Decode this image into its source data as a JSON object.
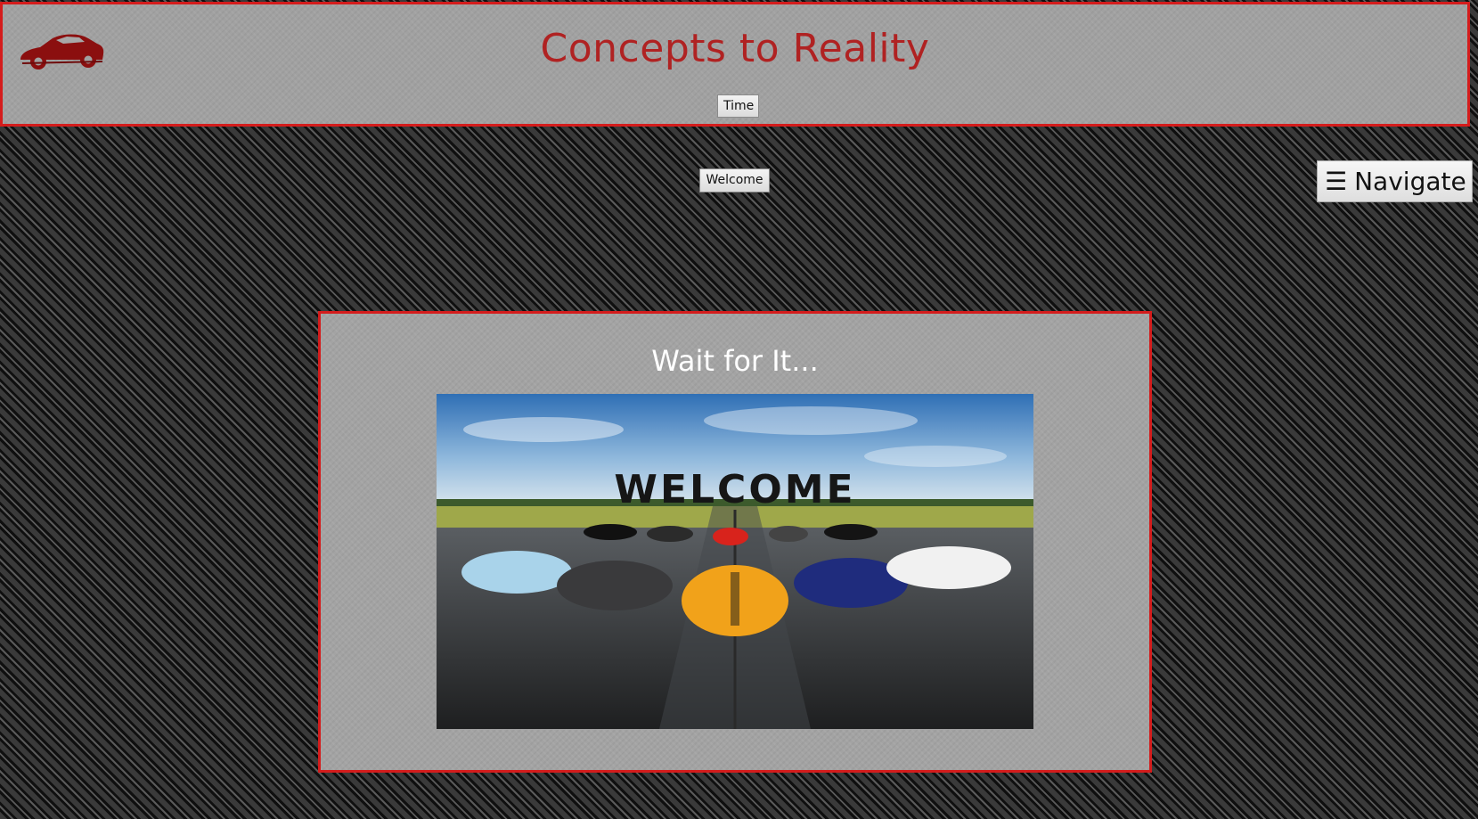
{
  "header": {
    "title": "Concepts to Reality",
    "time_button_label": "Time",
    "logo_icon": "sports-car-icon",
    "border_color": "#d41c1c",
    "title_color": "#b02222"
  },
  "nav": {
    "welcome_button_label": "Welcome",
    "navigate_icon": "☰",
    "navigate_label": "Navigate"
  },
  "main": {
    "heading": "Wait for It...",
    "hero_text": "WELCOME",
    "hero_image": "supercars-on-runway-image"
  }
}
